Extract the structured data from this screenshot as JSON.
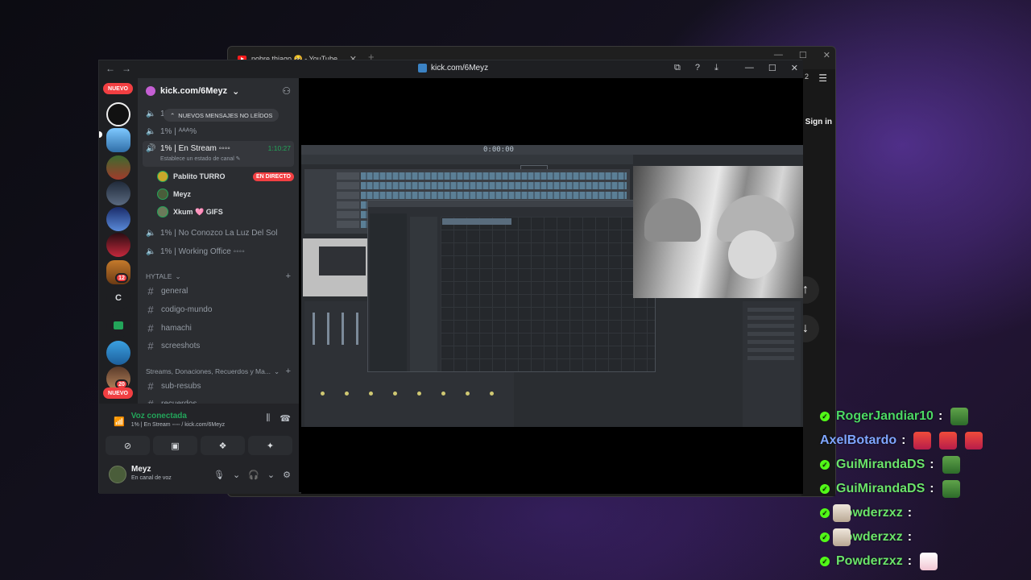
{
  "youtube": {
    "tab_title": "pobre thiago 🥺 - YouTube",
    "tab_close": "✕",
    "new_tab": "+",
    "sign_in": "Sign in",
    "badge": "2",
    "menu_glyph": "☰"
  },
  "discord": {
    "window_title": "kick.com/6Meyz",
    "nav": {
      "back": "←",
      "forward": "→"
    },
    "titlebar_tools": [
      "⧉",
      "?",
      "⤓"
    ],
    "window_controls": [
      "—",
      "☐",
      "✕"
    ],
    "rail": {
      "new_label_top": "NUEVO",
      "new_label_bottom": "NUEVO",
      "badge_12": "12",
      "badge_20": "20",
      "letter_server": "C"
    },
    "server_name": "kick.com/6Meyz",
    "unread_banner": "NUEVOS MENSAJES NO LEÍDOS",
    "channels_above": [
      {
        "label": "1%"
      },
      {
        "label": "1% | ᴬᴬᴬ%"
      }
    ],
    "active_voice": {
      "label": "1% | En Stream ◦◦◦◦",
      "status": "Establece un estado de canal ✎",
      "timer": "1:10:27",
      "users": [
        {
          "name": "Pablito TURRO",
          "tag": "EN DIRECTO"
        },
        {
          "name": "Meyz",
          "tag": ""
        },
        {
          "name": "Xkum 🩷 GIFS",
          "tag": ""
        }
      ]
    },
    "voice_channels": [
      {
        "label": "1% | No Conozco La Luz Del Sol"
      },
      {
        "label": "1% | Working Office ◦◦◦◦"
      }
    ],
    "category_1": "HYTALE",
    "text_channels": [
      "general",
      "codigo-mundo",
      "hamachi",
      "screeshots"
    ],
    "category_2": "Streams, Donaciones, Recuerdos y Ma...",
    "text_channels_2": [
      "sub-resubs",
      "recuerdos"
    ],
    "voice_panel": {
      "title": "Voz conectada",
      "subtitle": "1% | En Stream ◦◦◦◦ / kick.com/6Meyz"
    },
    "user": {
      "name": "Meyz",
      "status": "En canal de voz"
    }
  },
  "stream": {
    "fl_time": "0:00:00"
  },
  "chat": [
    {
      "user": "RogerJandiar10",
      "color": "#4cd964",
      "emotes": [
        "frog"
      ]
    },
    {
      "user": "AxelBotardo",
      "color": "#7fa6ff",
      "emotes": [
        "fire",
        "fire",
        "fire"
      ]
    },
    {
      "user": "GuiMirandaDS",
      "color": "#6be36b",
      "emotes": [
        "frog"
      ]
    },
    {
      "user": "GuiMirandaDS",
      "color": "#6be36b",
      "emotes": [
        "frog"
      ]
    },
    {
      "user": "Powderzxz",
      "color": "#6be36b",
      "emotes": [
        "cat"
      ]
    },
    {
      "user": "Powderzxz",
      "color": "#6be36b",
      "emotes": [
        "cat"
      ]
    },
    {
      "user": "Powderzxz",
      "color": "#6be36b",
      "emotes": [
        "cat2"
      ]
    }
  ]
}
